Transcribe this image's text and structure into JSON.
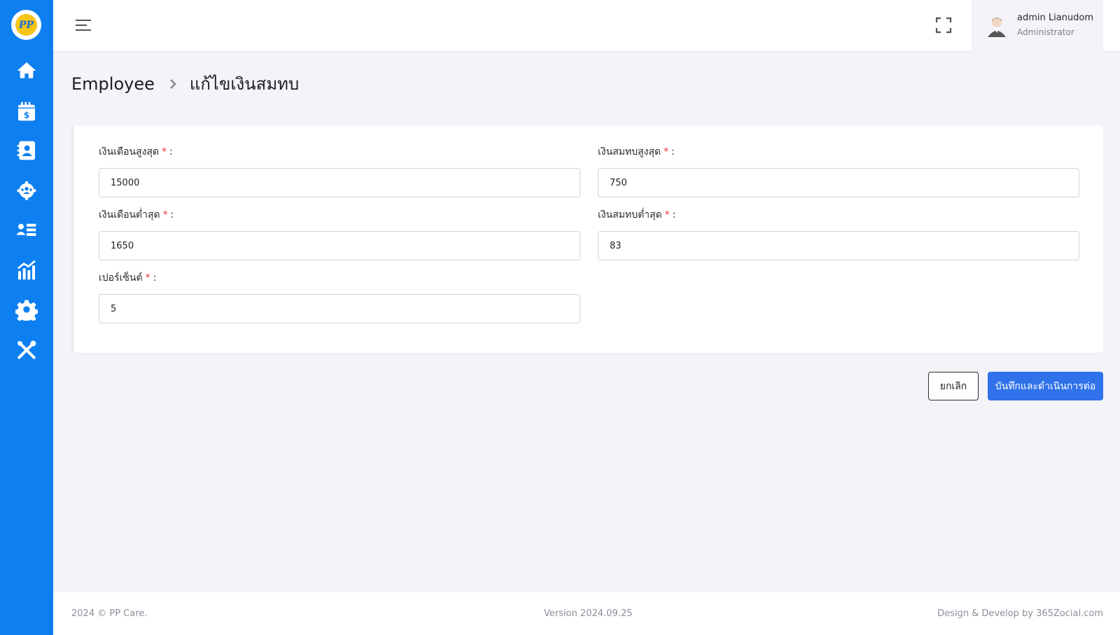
{
  "brand": {
    "logo_text": "PP",
    "primary_color": "#0d7ff0",
    "button_color": "#2f72ea",
    "required_color": "#e53935"
  },
  "sidebar": {
    "items": [
      {
        "icon": "home-icon"
      },
      {
        "icon": "salary-calendar-icon"
      },
      {
        "icon": "contact-book-icon"
      },
      {
        "icon": "team-gear-icon"
      },
      {
        "icon": "user-list-icon"
      },
      {
        "icon": "chart-icon"
      },
      {
        "icon": "gear-icon"
      },
      {
        "icon": "tools-icon"
      }
    ]
  },
  "header": {
    "user_name": "admin Lianudom",
    "user_role": "Administrator"
  },
  "breadcrumb": {
    "parent": "Employee",
    "current": "แก้ไขเงินสมทบ"
  },
  "form": {
    "max_salary": {
      "label": "เงินเดือนสูงสุด",
      "required": "*",
      "colon": ":",
      "value": "15000"
    },
    "max_contribution": {
      "label": "เงินสมทบสูงสุด",
      "required": "*",
      "colon": ":",
      "value": "750"
    },
    "min_salary": {
      "label": "เงินเดือนต่ำสุด",
      "required": "*",
      "colon": ":",
      "value": "1650"
    },
    "min_contribution": {
      "label": "เงินสมทบต่ำสุด",
      "required": "*",
      "colon": ":",
      "value": "83"
    },
    "percent": {
      "label": "เปอร์เซ็นต์",
      "required": "*",
      "colon": ":",
      "value": "5"
    }
  },
  "actions": {
    "cancel_label": "ยกเลิก",
    "save_label": "บันทึกและดำเนินการต่อ"
  },
  "footer": {
    "copyright": "2024 © PP Care.",
    "version": "Version 2024.09.25",
    "credit": "Design & Develop by 365Zocial.com"
  }
}
